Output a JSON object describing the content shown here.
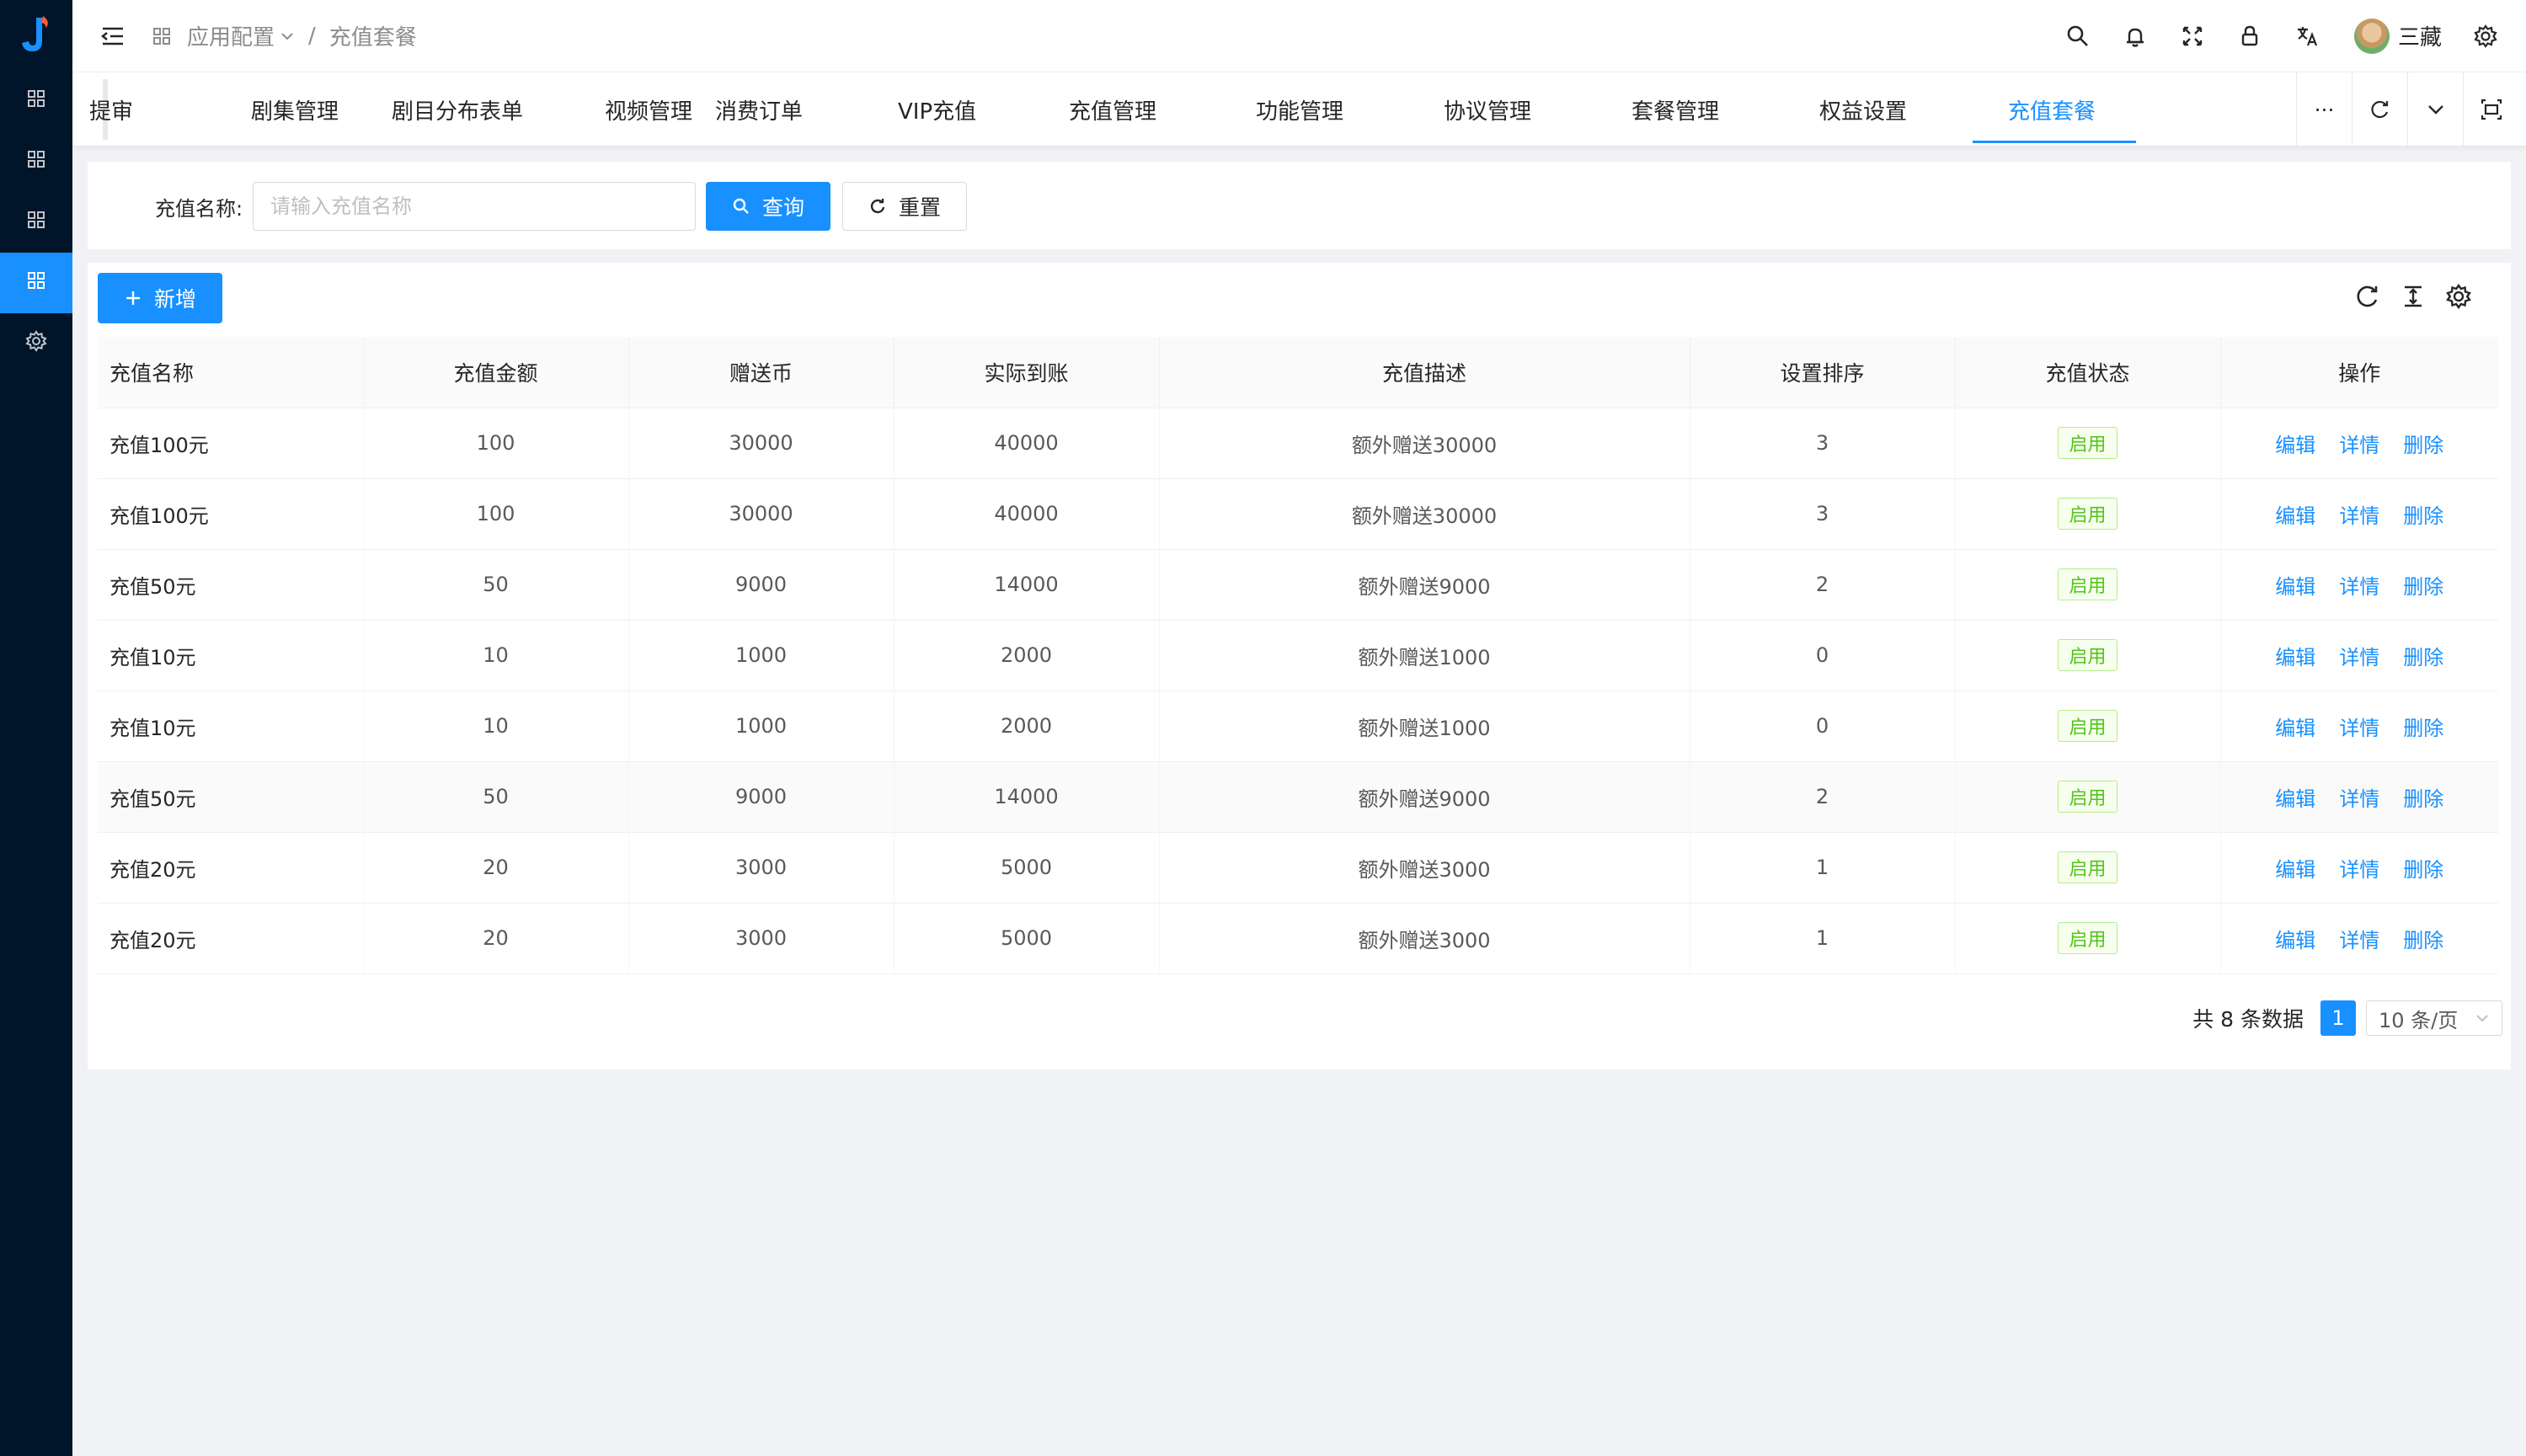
{
  "sidebar": {
    "items": [
      {
        "icon": "grid-icon",
        "active": false
      },
      {
        "icon": "grid-icon",
        "active": false
      },
      {
        "icon": "grid-icon",
        "active": false
      },
      {
        "icon": "grid-icon",
        "active": true
      },
      {
        "icon": "gear-icon",
        "active": false
      }
    ]
  },
  "header": {
    "breadcrumb": {
      "parent": "应用配置",
      "separator": "/",
      "current": "充值套餐"
    },
    "username": "三藏"
  },
  "tabs": [
    {
      "label": "提审",
      "active": false
    },
    {
      "label": "剧集管理",
      "active": false
    },
    {
      "label": "剧目分布表单",
      "active": false
    },
    {
      "label": "视频管理",
      "active": false
    },
    {
      "label": "消费订单",
      "active": false
    },
    {
      "label": "VIP充值",
      "active": false
    },
    {
      "label": "充值管理",
      "active": false
    },
    {
      "label": "功能管理",
      "active": false
    },
    {
      "label": "协议管理",
      "active": false
    },
    {
      "label": "套餐管理",
      "active": false
    },
    {
      "label": "权益设置",
      "active": false
    },
    {
      "label": "充值套餐",
      "active": true
    }
  ],
  "tab_more": "···",
  "search": {
    "label": "充值名称:",
    "placeholder": "请输入充值名称",
    "value": "",
    "query_label": "查询",
    "reset_label": "重置"
  },
  "toolbar": {
    "add_label": "新增"
  },
  "table": {
    "columns": [
      "充值名称",
      "充值金额",
      "赠送币",
      "实际到账",
      "充值描述",
      "设置排序",
      "充值状态",
      "操作"
    ],
    "rows": [
      {
        "name": "充值100元",
        "amount": "100",
        "bonus": "30000",
        "actual": "40000",
        "desc": "额外赠送30000",
        "sort": "3",
        "status": "启用"
      },
      {
        "name": "充值100元",
        "amount": "100",
        "bonus": "30000",
        "actual": "40000",
        "desc": "额外赠送30000",
        "sort": "3",
        "status": "启用"
      },
      {
        "name": "充值50元",
        "amount": "50",
        "bonus": "9000",
        "actual": "14000",
        "desc": "额外赠送9000",
        "sort": "2",
        "status": "启用"
      },
      {
        "name": "充值10元",
        "amount": "10",
        "bonus": "1000",
        "actual": "2000",
        "desc": "额外赠送1000",
        "sort": "0",
        "status": "启用"
      },
      {
        "name": "充值10元",
        "amount": "10",
        "bonus": "1000",
        "actual": "2000",
        "desc": "额外赠送1000",
        "sort": "0",
        "status": "启用"
      },
      {
        "name": "充值50元",
        "amount": "50",
        "bonus": "9000",
        "actual": "14000",
        "desc": "额外赠送9000",
        "sort": "2",
        "status": "启用"
      },
      {
        "name": "充值20元",
        "amount": "20",
        "bonus": "3000",
        "actual": "5000",
        "desc": "额外赠送3000",
        "sort": "1",
        "status": "启用"
      },
      {
        "name": "充值20元",
        "amount": "20",
        "bonus": "3000",
        "actual": "5000",
        "desc": "额外赠送3000",
        "sort": "1",
        "status": "启用"
      }
    ],
    "actions": [
      "编辑",
      "详情",
      "删除"
    ]
  },
  "pagination": {
    "total_text": "共 8 条数据",
    "current_page": "1",
    "page_size": "10 条/页"
  },
  "colors": {
    "primary": "#1890ff",
    "sidebar": "#001529",
    "success": "#52c41a"
  }
}
